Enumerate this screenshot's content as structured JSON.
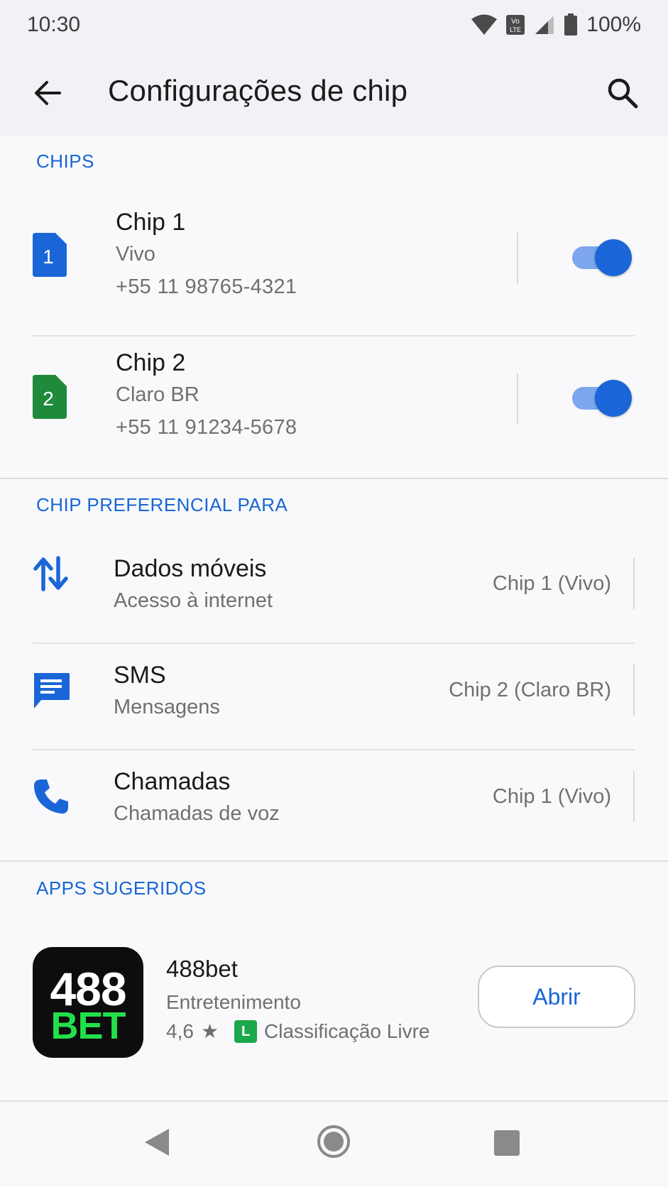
{
  "status_bar": {
    "time": "10:30",
    "volte_label": "Vo LTE",
    "battery": "100%",
    "icons": [
      "wifi-icon",
      "volte-icon",
      "cell-signal-icon",
      "battery-icon"
    ]
  },
  "app_bar": {
    "title": "Configurações de chip",
    "back_icon": "arrow-back-icon",
    "search_icon": "search-icon"
  },
  "chips_section": {
    "header": "CHIPS",
    "chips": [
      {
        "badge": "1",
        "name": "Chip 1",
        "carrier": "Vivo",
        "number": "+55 11 98765-4321",
        "enabled": true,
        "color": "#1a66d8"
      },
      {
        "badge": "2",
        "name": "Chip 2",
        "carrier": "Claro BR",
        "number": "+55 11 91234-5678",
        "enabled": true,
        "color": "#1e8a3a"
      }
    ]
  },
  "preferred_section": {
    "header": "CHIP PREFERENCIAL PARA",
    "items": [
      {
        "icon": "swap-vertical-icon",
        "title": "Dados móveis",
        "subtitle": "Acesso à internet",
        "value": "Chip 1 (Vivo)"
      },
      {
        "icon": "message-icon",
        "title": "SMS",
        "subtitle": "Mensagens",
        "value": "Chip 2 (Claro BR)"
      },
      {
        "icon": "phone-icon",
        "title": "Chamadas",
        "subtitle": "Chamadas de voz",
        "value": "Chip 1 (Vivo)"
      }
    ]
  },
  "suggested_section": {
    "header": "APPS SUGERIDOS",
    "app": {
      "icon_line1": "488",
      "icon_line2": "BET",
      "name": "488bet",
      "category": "Entretenimento",
      "rating": "4,6",
      "rating_star": "★",
      "age_badge": "L",
      "age_rating": "Classificação Livre",
      "button": "Abrir"
    }
  },
  "nav_bar": {
    "icons": [
      "nav-back-icon",
      "nav-home-icon",
      "nav-recents-icon"
    ]
  },
  "colors": {
    "accent": "#1766d6",
    "toggle_on": "#1a66d8",
    "chip2_green": "#1e8a3a",
    "brand_green": "#22e04a"
  }
}
